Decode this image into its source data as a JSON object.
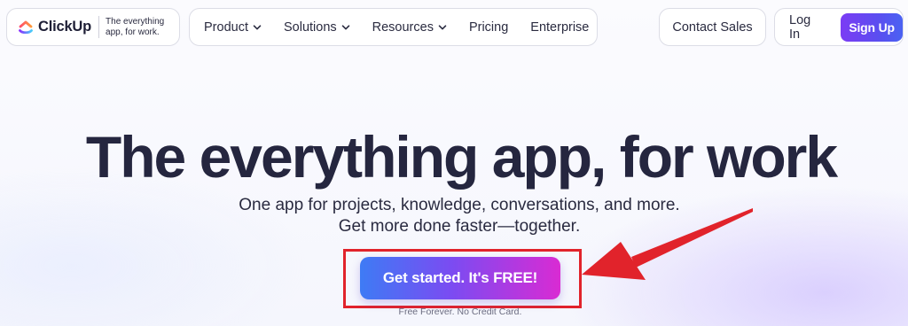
{
  "header": {
    "logo": {
      "wordmark": "ClickUp",
      "tagline_line1": "The everything",
      "tagline_line2": "app, for work."
    },
    "nav": {
      "items": [
        {
          "label": "Product",
          "has_dropdown": true
        },
        {
          "label": "Solutions",
          "has_dropdown": true
        },
        {
          "label": "Resources",
          "has_dropdown": true
        },
        {
          "label": "Pricing",
          "has_dropdown": false
        },
        {
          "label": "Enterprise",
          "has_dropdown": false
        }
      ]
    },
    "contact_sales_label": "Contact Sales",
    "login_label": "Log In",
    "signup_label": "Sign Up"
  },
  "hero": {
    "title": "The everything app, for work",
    "subtitle_line1": "One app for projects, knowledge, conversations, and more.",
    "subtitle_line2": "Get more done faster—together.",
    "cta_label": "Get started. It's FREE!",
    "cta_note": "Free Forever. No Credit Card."
  },
  "annotations": {
    "highlight_color": "#e1232b",
    "arrow_color": "#e1232b"
  },
  "icons": {
    "logo": "clickup-logo-icon",
    "dropdown": "chevron-down-icon"
  },
  "colors": {
    "signup_gradient": [
      "#7b3cf4",
      "#4a62f2"
    ],
    "cta_gradient": [
      "#3e7bf5",
      "#7a4cf2",
      "#d92bd3"
    ],
    "title_text": "#25263f"
  }
}
